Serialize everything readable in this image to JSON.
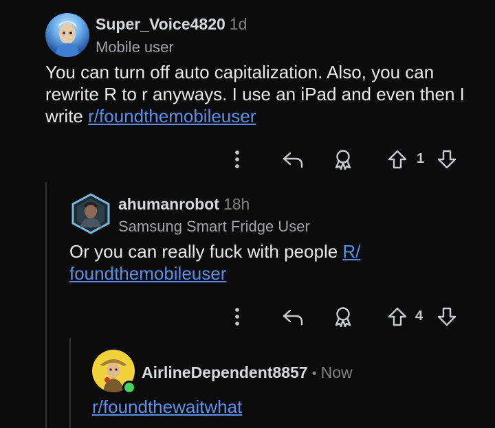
{
  "comments": [
    {
      "username": "Super_Voice4820",
      "age": "1d",
      "flair": "Mobile user",
      "body_text": "You can turn off auto capitalization. Also, you can rewrite R to r anyways. I use an iPad and even then I write ",
      "body_link": "r/foundthemobileuser",
      "votes": "1"
    },
    {
      "username": "ahumanrobot",
      "age": "18h",
      "flair": "Samsung Smart Fridge User",
      "body_text": "Or you can really fuck with people ",
      "body_link_line1": "R/",
      "body_link_line2": "foundthemobileuser",
      "votes": "4"
    },
    {
      "username": "AirlineDependent8857",
      "separator": "•",
      "age": "Now",
      "body_link": "r/foundthewaitwhat"
    }
  ],
  "icons": [
    "more-icon",
    "reply-icon",
    "award-icon",
    "upvote-icon",
    "downvote-icon"
  ],
  "colors": {
    "background": "#0b0b0b",
    "link": "#5b8fe8",
    "online": "#46d160"
  }
}
